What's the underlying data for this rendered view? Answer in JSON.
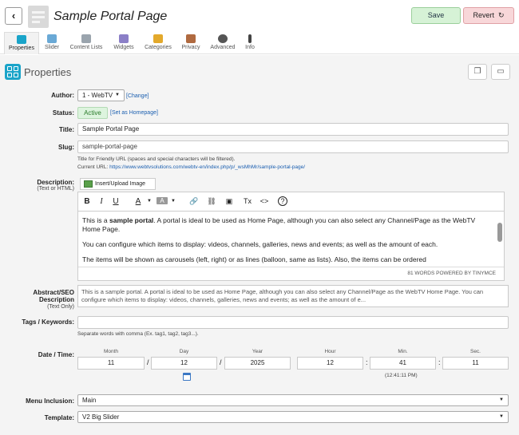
{
  "header": {
    "back_icon": "‹",
    "title": "Sample Portal Page",
    "save_label": "Save",
    "revert_label": "Revert",
    "revert_icon": "↻"
  },
  "tabs": [
    {
      "label": "Properties",
      "icon": "grid-icon",
      "color": "#1aa4c9"
    },
    {
      "label": "Slider",
      "icon": "slider-icon",
      "color": "#6aa9d6"
    },
    {
      "label": "Content Lists",
      "icon": "list-icon",
      "color": "#9aa4ad"
    },
    {
      "label": "Widgets",
      "icon": "widgets-icon",
      "color": "#8b7fc7"
    },
    {
      "label": "Categories",
      "icon": "folder-icon",
      "color": "#e3a92c"
    },
    {
      "label": "Privacy",
      "icon": "users-icon",
      "color": "#b06a40"
    },
    {
      "label": "Advanced",
      "icon": "gear-icon",
      "color": "#555555"
    },
    {
      "label": "Info",
      "icon": "info-icon",
      "color": "#444444"
    }
  ],
  "section": {
    "title": "Properties"
  },
  "author": {
    "label": "Author:",
    "value": "1 - WebTV",
    "change_link": "[Change]"
  },
  "status": {
    "label": "Status:",
    "value": "Active",
    "homepage_link": "[Set as Homepage]"
  },
  "title_field": {
    "label": "Title:",
    "value": "Sample Portal Page"
  },
  "slug": {
    "label": "Slug:",
    "value": "sample-portal-page",
    "help": "Title for Friendly URL (spaces and special characters will be filtered).",
    "current_url_label": "Current URL:",
    "current_url": "https://www.webtvsolutions.com/webtv-en/index.php/p/_wsMhMr/sample-portal-page/"
  },
  "description": {
    "label": "Description:",
    "sublabel": "(Text or HTML)",
    "upload_label": "Insert/Upload Image",
    "toolbar": [
      "B",
      "I",
      "U",
      "A",
      "A",
      "🔗",
      "⛓",
      "▣",
      "Tx",
      "<>",
      "?"
    ],
    "p1_pre": "This is a ",
    "p1_bold": "sample portal",
    "p1_post": ". A portal is ideal to be used as Home Page, although you can also select any Channel/Page as the WebTV Home Page.",
    "p2": "You can configure which items to display: videos, channels, galleries, news and events; as well as the amount of each.",
    "p3": "The items will be shown as carousels (left, right) or as lines (balloon, same as lists). Also, the items can be ordered",
    "status": "81 WORDS POWERED BY TINYMCE"
  },
  "abstract": {
    "label": "Abstract/SEO",
    "label2": "Description",
    "sublabel": "(Text Only)",
    "value": "This is a sample portal. A portal is ideal to be used as Home Page, although you can also select any Channel/Page as the WebTV Home Page. You can configure which items to display: videos, channels, galleries, news and events; as well as the amount of e..."
  },
  "tags": {
    "label": "Tags / Keywords:",
    "value": "",
    "help": "Separate words with comma (Ex. tag1, tag2, tag3...)."
  },
  "datetime": {
    "label": "Date / Time:",
    "month_label": "Month",
    "month": "11",
    "day_label": "Day",
    "day": "12",
    "year_label": "Year",
    "year": "2025",
    "hour_label": "Hour",
    "hour": "12",
    "min_label": "Min.",
    "min": "41",
    "sec_label": "Sec.",
    "sec": "11",
    "date_sep": "/",
    "time_sep": ":",
    "time_preview": "(12:41:11 PM)"
  },
  "menu_inclusion": {
    "label": "Menu Inclusion:",
    "value": "Main"
  },
  "template": {
    "label": "Template:",
    "value": "V2 Big Slider"
  }
}
